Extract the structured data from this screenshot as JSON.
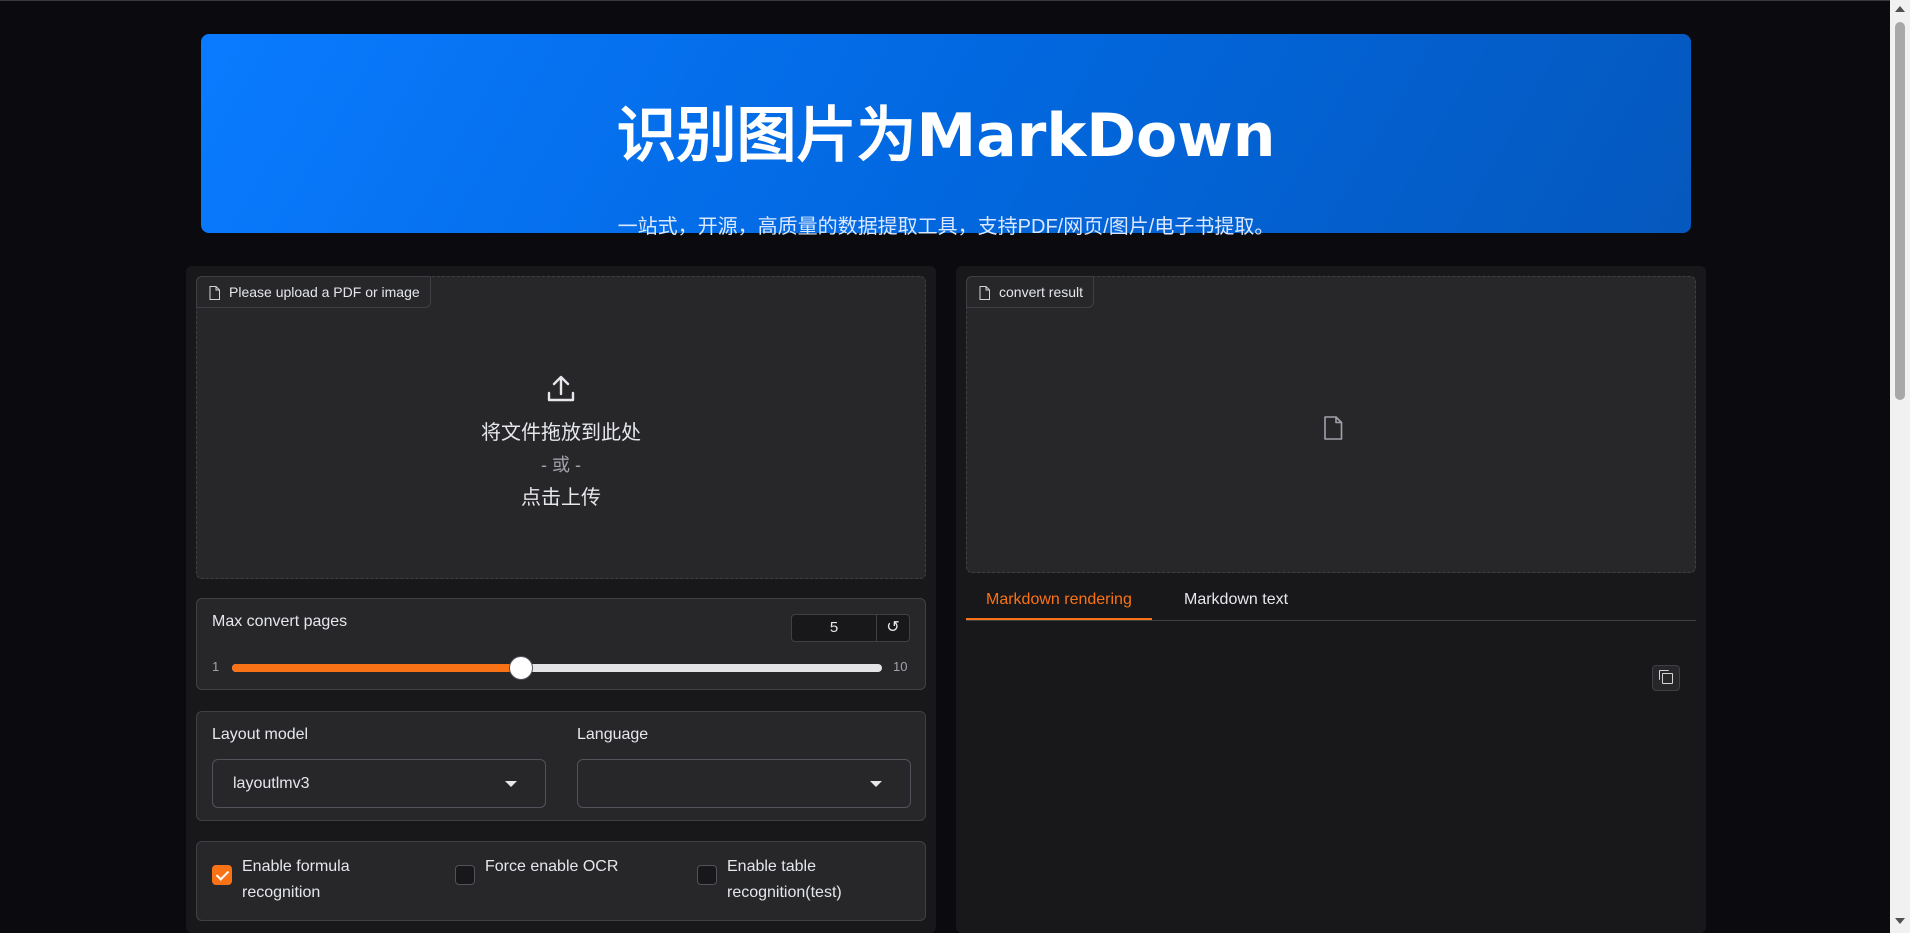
{
  "header": {
    "title": "识别图片为MarkDown",
    "subtitle": "一站式，开源，高质量的数据提取工具，支持PDF/网页/图片/电子书提取。"
  },
  "upload": {
    "label": "Please upload a PDF or image",
    "drop_text": "将文件拖放到此处",
    "or_text": "- 或 -",
    "click_text": "点击上传"
  },
  "slider": {
    "label": "Max convert pages",
    "value": "5",
    "min": "1",
    "max": "10",
    "reset_icon": "↺",
    "fraction": 0.4444
  },
  "layout_model": {
    "label": "Layout model",
    "value": "layoutlmv3"
  },
  "language": {
    "label": "Language",
    "value": ""
  },
  "checkboxes": [
    {
      "label": "Enable formula recognition",
      "checked": true
    },
    {
      "label": "Force enable OCR",
      "checked": false
    },
    {
      "label": "Enable table recognition(test)",
      "checked": false
    }
  ],
  "result": {
    "label": "convert result"
  },
  "tabs": [
    {
      "label": "Markdown rendering",
      "active": true
    },
    {
      "label": "Markdown text",
      "active": false
    }
  ],
  "colors": {
    "accent": "#f97316",
    "header_start": "#0a7bff",
    "header_end": "#0558bd",
    "background": "#0b0b0f",
    "panel": "#27272a"
  },
  "icons": {
    "upload": "upload-icon",
    "file": "file-icon",
    "copy": "copy-icon",
    "reset": "reset-icon"
  }
}
